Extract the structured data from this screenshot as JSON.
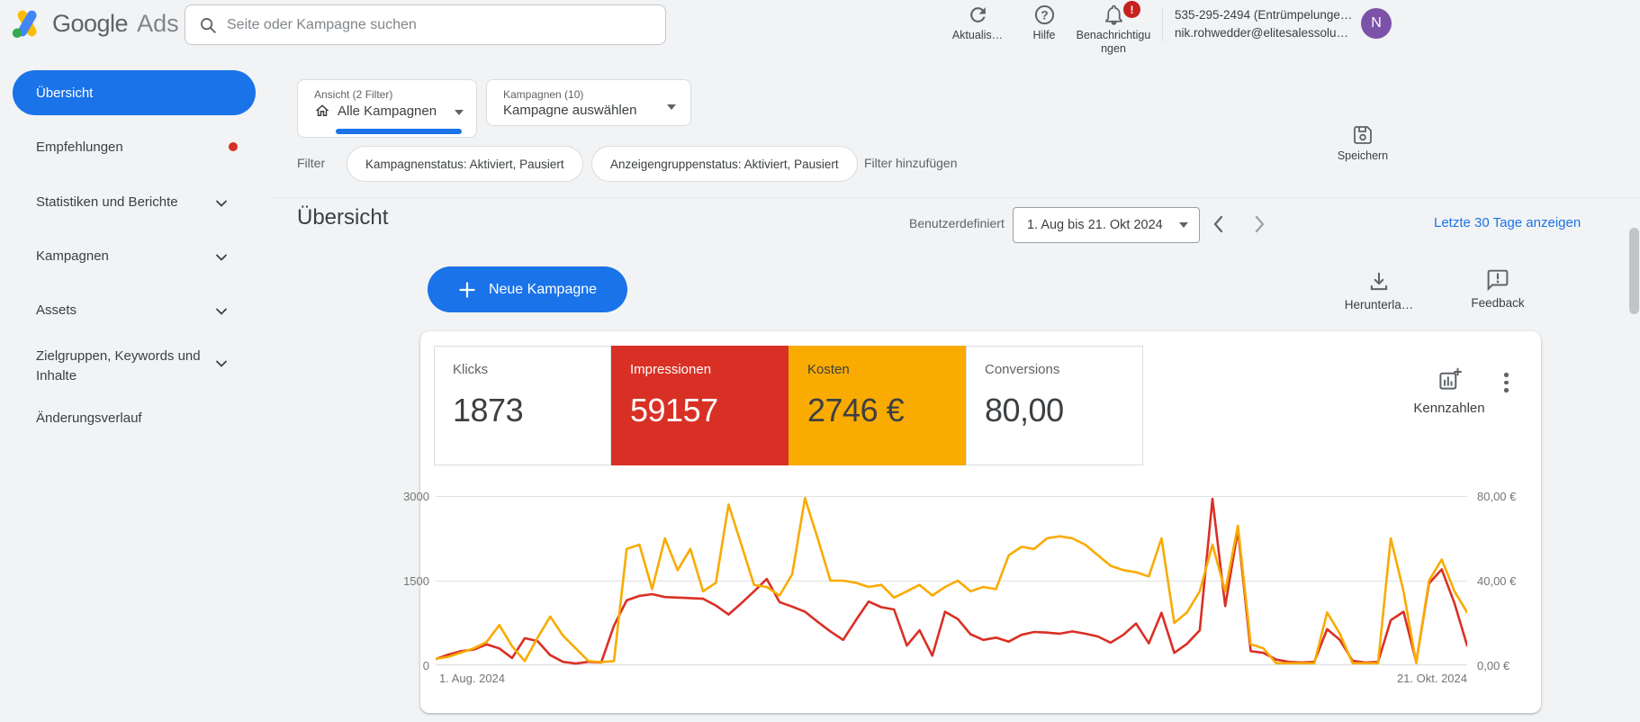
{
  "topbar": {
    "logo_google": "Google",
    "logo_ads": "Ads",
    "search_placeholder": "Seite oder Kampagne suchen",
    "refresh_label": "Aktualis…",
    "help_label": "Hilfe",
    "notifications_label": "Benachrichtigungen",
    "notification_badge": "!",
    "account_id": "535-295-2494 (Entrümpelunge…",
    "account_email": "nik.rohwedder@elitesalessolu…",
    "avatar_initial": "N"
  },
  "sidebar": {
    "items": [
      {
        "label": "Übersicht",
        "selected": true
      },
      {
        "label": "Empfehlungen",
        "badge": "red-dot"
      },
      {
        "label": "Statistiken und Berichte",
        "expandable": true
      },
      {
        "label": "Kampagnen",
        "expandable": true
      },
      {
        "label": "Assets",
        "expandable": true
      },
      {
        "label": "Zielgruppen, Keywords und Inhalte",
        "expandable": true
      },
      {
        "label": "Änderungsverlauf"
      }
    ]
  },
  "controls": {
    "view_label": "Ansicht (2 Filter)",
    "view_value": "Alle Kampagnen",
    "campaign_label": "Kampagnen (10)",
    "campaign_value": "Kampagne auswählen"
  },
  "filterbar": {
    "filter_label": "Filter",
    "chips": [
      {
        "label": "Kampagnenstatus: Aktiviert, Pausiert"
      },
      {
        "label": "Anzeigengruppenstatus: Aktiviert, Pausiert"
      }
    ],
    "add_filter": "Filter hinzufügen",
    "save_label": "Speichern"
  },
  "overview": {
    "title": "Übersicht",
    "date_mode": "Benutzerdefiniert",
    "date_range": "1. Aug bis 21. Okt 2024",
    "last30_link": "Letzte 30 Tage anzeigen",
    "new_campaign": "Neue Kampagne",
    "download_label": "Herunterla…",
    "feedback_label": "Feedback",
    "metrics_label": "Kennzahlen"
  },
  "metrics": [
    {
      "label": "Klicks",
      "value": "1873",
      "selected": false
    },
    {
      "label": "Impressionen",
      "value": "59157",
      "selected": true,
      "color": "#d93025"
    },
    {
      "label": "Kosten",
      "value": "2746 €",
      "selected": true,
      "color": "#f9ab00"
    },
    {
      "label": "Conversions",
      "value": "80,00",
      "selected": false
    }
  ],
  "colors": {
    "accent_blue": "#1a73e8",
    "metric_red": "#d93025",
    "metric_orange": "#f9ab00",
    "link_blue": "#1a73e8",
    "badge_red": "#c5221f",
    "avatar_purple": "#7b52a8",
    "recommendation_dot": "#d93025"
  },
  "icons": {
    "search": "magnifier",
    "refresh": "circular-arrow",
    "help": "question-circle",
    "notifications": "bell",
    "save": "floppy-disk",
    "home": "house",
    "download": "arrow-into-tray",
    "feedback": "speech-bubble-exclamation",
    "metrics": "bar-chart-plus",
    "menu": "kebab-dots",
    "add": "plus"
  },
  "chart_data": {
    "type": "line",
    "title": "",
    "x_start_label": "1. Aug. 2024",
    "x_end_label": "21. Okt. 2024",
    "x_range_days": 82,
    "grid": true,
    "legend": "none (colors match metric cards)",
    "left_axis": {
      "range": [
        0,
        3000
      ],
      "tick_labels": [
        "0",
        "1500",
        "3000"
      ]
    },
    "right_axis": {
      "range": [
        0,
        80
      ],
      "tick_labels": [
        "0,00 €",
        "40,00 €",
        "80,00 €"
      ]
    },
    "series": [
      {
        "name": "Impressionen",
        "axis": "left",
        "color": "#d93025",
        "values": [
          110,
          190,
          250,
          280,
          370,
          300,
          130,
          480,
          430,
          180,
          60,
          30,
          60,
          50,
          700,
          1150,
          1230,
          1260,
          1210,
          1200,
          1190,
          1180,
          1060,
          900,
          1100,
          1310,
          1530,
          1120,
          1040,
          950,
          770,
          600,
          450,
          800,
          1130,
          1030,
          990,
          350,
          620,
          170,
          950,
          820,
          550,
          450,
          490,
          420,
          540,
          590,
          580,
          560,
          600,
          560,
          510,
          400,
          540,
          740,
          390,
          930,
          220,
          380,
          620,
          2950,
          1050,
          2400,
          250,
          220,
          100,
          60,
          50,
          60,
          640,
          450,
          80,
          50,
          60,
          800,
          950,
          60,
          1450,
          1700,
          1100,
          350
        ]
      },
      {
        "name": "Kosten",
        "axis": "right",
        "color": "#f9ab00",
        "values": [
          3,
          4,
          6,
          8,
          11,
          19,
          9,
          2,
          13,
          23,
          14,
          8,
          2,
          1.5,
          2,
          55,
          57,
          36,
          60,
          45,
          55,
          35,
          39,
          76,
          57,
          38,
          37,
          33,
          43,
          79,
          60,
          40,
          40,
          39,
          37,
          38,
          32,
          35,
          38,
          33,
          37,
          40,
          35,
          37,
          36,
          52,
          56,
          55,
          60,
          61,
          60,
          57,
          52,
          47,
          45,
          44,
          42,
          60,
          20,
          25,
          35,
          57,
          35,
          66,
          10,
          8,
          1,
          1,
          1,
          1,
          25,
          15,
          1,
          1,
          1,
          60,
          35,
          1,
          40,
          50,
          35,
          25
        ]
      }
    ]
  }
}
